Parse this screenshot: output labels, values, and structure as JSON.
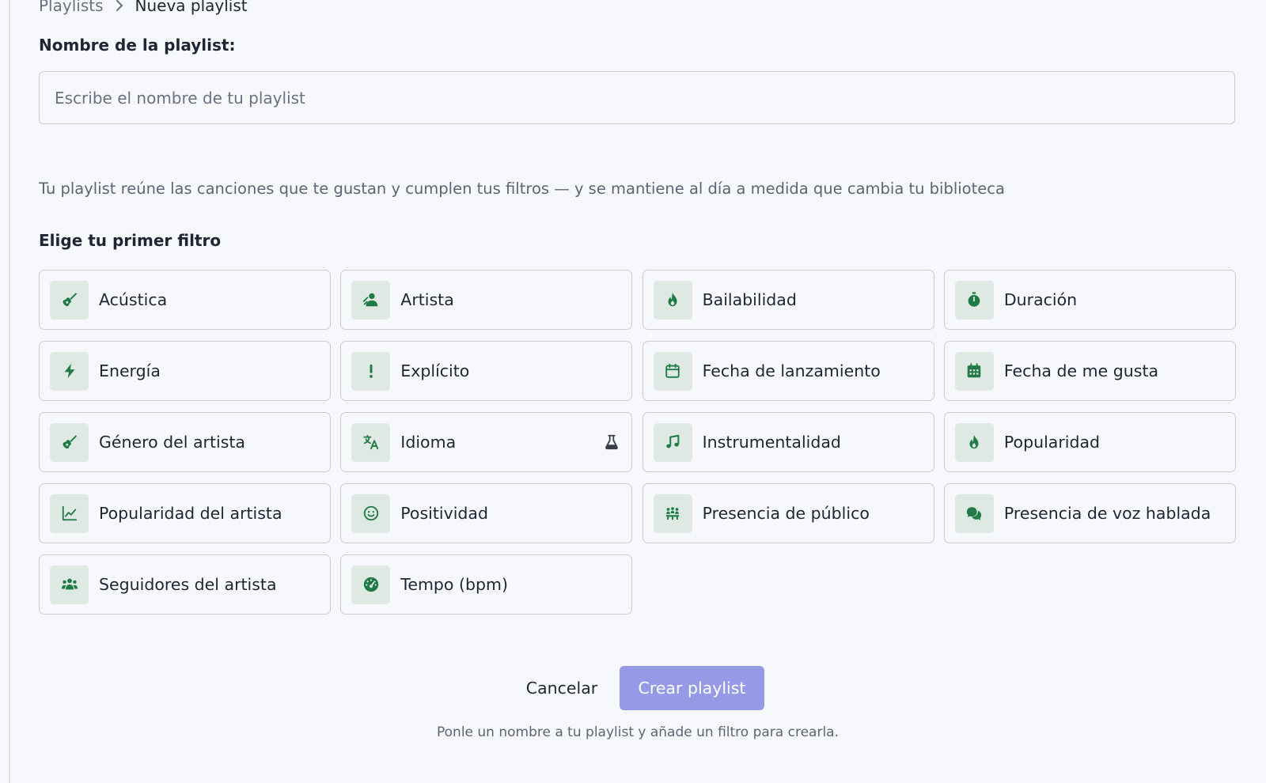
{
  "breadcrumb": {
    "parent": "Playlists",
    "current": "Nueva playlist"
  },
  "form": {
    "name_label": "Nombre de la playlist:",
    "name_value": "",
    "name_placeholder": "Escribe el nombre de tu playlist",
    "description": "Tu playlist reúne las canciones que te gustan y cumplen tus filtros — y se mantiene al día a medida que cambia tu biblioteca",
    "filter_heading": "Elige tu primer filtro"
  },
  "filters": [
    {
      "label": "Acústica",
      "icon": "guitar-icon"
    },
    {
      "label": "Artista",
      "icon": "artist-icon"
    },
    {
      "label": "Bailabilidad",
      "icon": "flame-icon"
    },
    {
      "label": "Duración",
      "icon": "stopwatch-icon"
    },
    {
      "label": "Energía",
      "icon": "bolt-icon"
    },
    {
      "label": "Explícito",
      "icon": "exclamation-icon"
    },
    {
      "label": "Fecha de lanzamiento",
      "icon": "calendar-outline-icon"
    },
    {
      "label": "Fecha de me gusta",
      "icon": "calendar-filled-icon"
    },
    {
      "label": "Género del artista",
      "icon": "guitar-icon"
    },
    {
      "label": "Idioma",
      "icon": "translate-icon",
      "beta_icon": "flask-icon"
    },
    {
      "label": "Instrumentalidad",
      "icon": "music-note-icon"
    },
    {
      "label": "Popularidad",
      "icon": "flame-icon"
    },
    {
      "label": "Popularidad del artista",
      "icon": "line-chart-icon"
    },
    {
      "label": "Positividad",
      "icon": "smile-icon"
    },
    {
      "label": "Presencia de público",
      "icon": "audience-icon"
    },
    {
      "label": "Presencia de voz hablada",
      "icon": "speech-bubbles-icon"
    },
    {
      "label": "Seguidores del artista",
      "icon": "users-icon"
    },
    {
      "label": "Tempo (bpm)",
      "icon": "gauge-icon"
    }
  ],
  "actions": {
    "cancel_label": "Cancelar",
    "create_label": "Crear playlist",
    "create_disabled": true,
    "hint": "Ponle un nombre a tu playlist y añade un filtro para crearla."
  },
  "colors": {
    "accent": "#949ae6",
    "icon_green": "#1f7a45",
    "icon_bg": "#dde9e2",
    "border": "#c9ccd4",
    "background": "#f7f8fb"
  }
}
